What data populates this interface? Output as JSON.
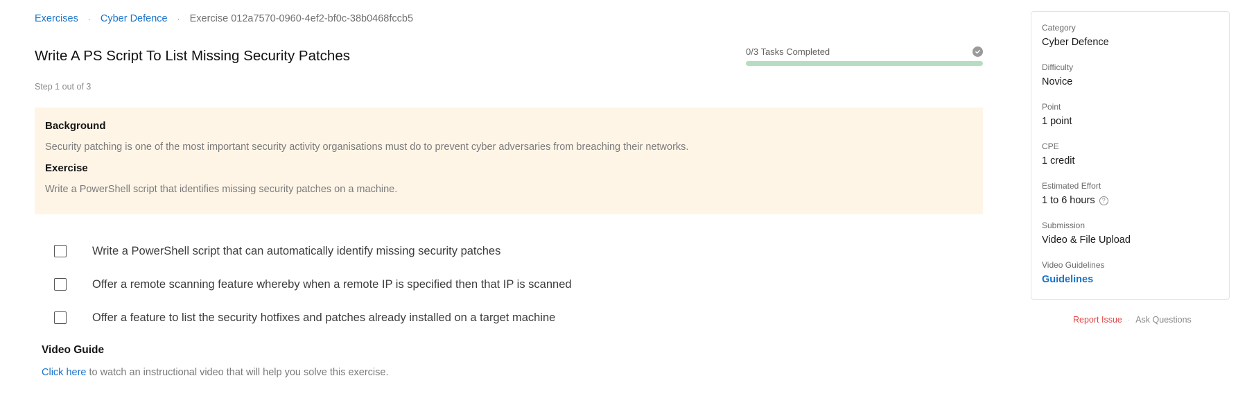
{
  "breadcrumb": {
    "items": [
      "Exercises",
      "Cyber Defence"
    ],
    "current": "Exercise 012a7570-0960-4ef2-bf0c-38b0468fccb5",
    "separator": "·"
  },
  "title": "Write A PS Script To List Missing Security Patches",
  "progress": {
    "label": "0/3 Tasks Completed",
    "completed": 0,
    "total": 3
  },
  "step_label": "Step 1 out of 3",
  "background": {
    "heading": "Background",
    "text": "Security patching is one of the most important security activity organisations must do to prevent cyber adversaries from breaching their networks.",
    "exercise_heading": "Exercise",
    "exercise_text": "Write a PowerShell script that identifies missing security patches on a machine."
  },
  "tasks": [
    {
      "label": "Write a PowerShell script that can automatically identify missing security patches",
      "checked": false
    },
    {
      "label": "Offer a remote scanning feature whereby when a remote IP is specified then that IP is scanned",
      "checked": false
    },
    {
      "label": "Offer a feature to list the security hotfixes and patches already installed on a target machine",
      "checked": false
    }
  ],
  "video_guide": {
    "heading": "Video Guide",
    "link_text": "Click here",
    "text": " to watch an instructional video that will help you solve this exercise."
  },
  "sidebar": {
    "items": [
      {
        "label": "Category",
        "value": "Cyber Defence"
      },
      {
        "label": "Difficulty",
        "value": "Novice"
      },
      {
        "label": "Point",
        "value": "1 point"
      },
      {
        "label": "CPE",
        "value": "1 credit"
      },
      {
        "label": "Estimated Effort",
        "value": "1 to 6 hours",
        "help_icon": "?"
      },
      {
        "label": "Submission",
        "value": "Video & File Upload"
      },
      {
        "label": "Video Guidelines",
        "value": "Guidelines"
      }
    ],
    "footer": {
      "report": "Report Issue",
      "separator": "·",
      "ask": "Ask Questions"
    }
  },
  "colors": {
    "link": "#1a73c9",
    "panel_bg": "#fef5e7",
    "progress_track": "#b7dcc2",
    "report": "#e04848"
  }
}
